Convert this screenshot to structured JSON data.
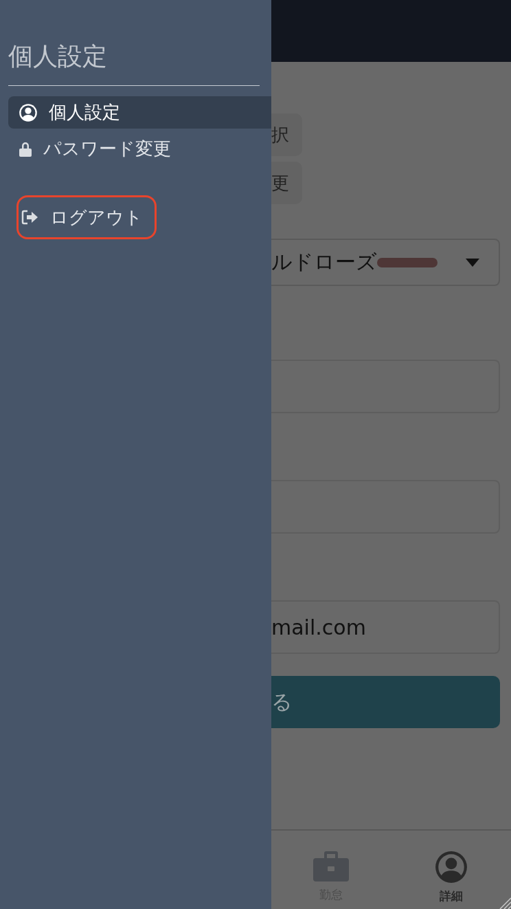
{
  "drawer": {
    "title": "個人設定",
    "items": [
      {
        "label": "個人設定",
        "kind": "user",
        "selected": true
      },
      {
        "label": "パスワード変更",
        "kind": "lock",
        "selected": false
      }
    ],
    "logout": {
      "label": "ログアウト",
      "highlighted": true
    }
  },
  "page": {
    "buttons": [
      "択",
      "更"
    ],
    "select": {
      "value": "ルドローズ"
    },
    "fields": [
      {
        "kind": "blank"
      },
      {
        "kind": "blank"
      },
      {
        "kind": "filled",
        "value": "mail.com"
      }
    ],
    "submit": "る"
  },
  "nav": [
    {
      "label": "勤怠",
      "kind": "briefcase",
      "selected": false
    },
    {
      "label": "詳細",
      "kind": "user",
      "selected": true
    }
  ]
}
